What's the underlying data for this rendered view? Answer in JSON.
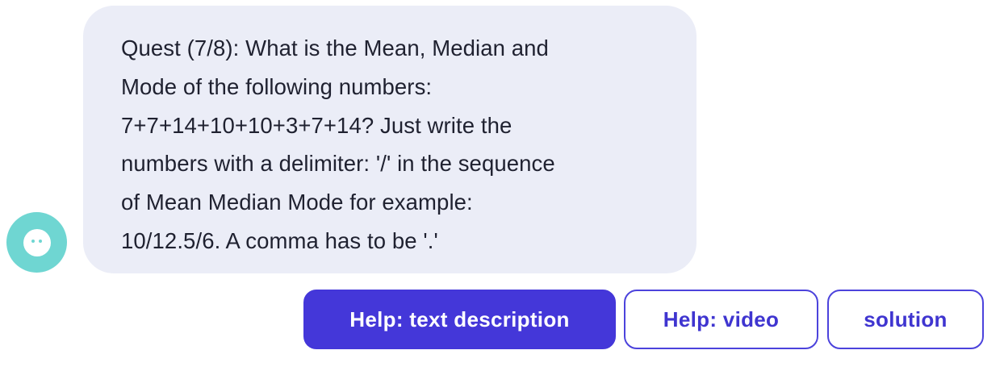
{
  "chat": {
    "bot_avatar_icon": "chatbot-face-icon",
    "message": "Quest (7/8): What is the Mean, Median and\nMode of the following numbers:\n7+7+14+10+10+3+7+14? Just write the\nnumbers with a delimiter: '/' in the sequence\nof Mean Median Mode for example:\n10/12.5/6. A comma has to be '.'"
  },
  "quick_replies": {
    "help_text_label": "Help: text description",
    "help_video_label": "Help: video",
    "solution_label": "solution"
  },
  "colors": {
    "bubble_background": "#ebedf7",
    "avatar": "#6fd6d2",
    "primary_button": "#4437d9",
    "outline_border": "#4c43dc"
  }
}
